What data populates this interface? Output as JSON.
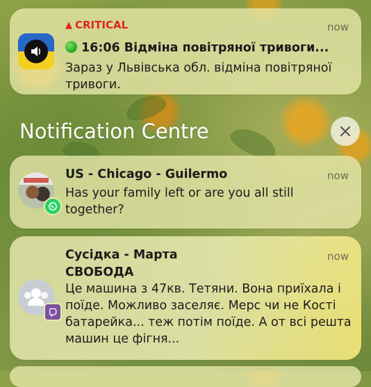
{
  "notifications": [
    {
      "app_icon": "air-alert-speaker-icon",
      "priority": "CRITICAL",
      "title": "16:06 Відміна повітряної тривоги...",
      "body": "Зараз у Львівська обл. відміна повітряної тривоги.",
      "time": "now"
    },
    {
      "app_icon": "whatsapp-icon",
      "title": "US - Chicago - Guilermo",
      "body": "Has your family left or are you all still together?",
      "time": "now"
    },
    {
      "app_icon": "viber-icon",
      "title": "Сусідка - Марта",
      "subtitle": "СВОБОДА",
      "body": "Це машина з 47кв. Тетяни. Вона приїхала і поїде. Можливо заселяє. Мерс чи не Кості батарейка... теж потім поїде. А от всі решта машин це фігня...",
      "time": "now"
    }
  ],
  "notification_centre": {
    "title": "Notification Centre",
    "close_icon": "close-icon"
  },
  "colors": {
    "critical": "#e0241b",
    "card": "#e8e8aa",
    "whatsapp": "#25d366",
    "viber": "#7b519d"
  }
}
